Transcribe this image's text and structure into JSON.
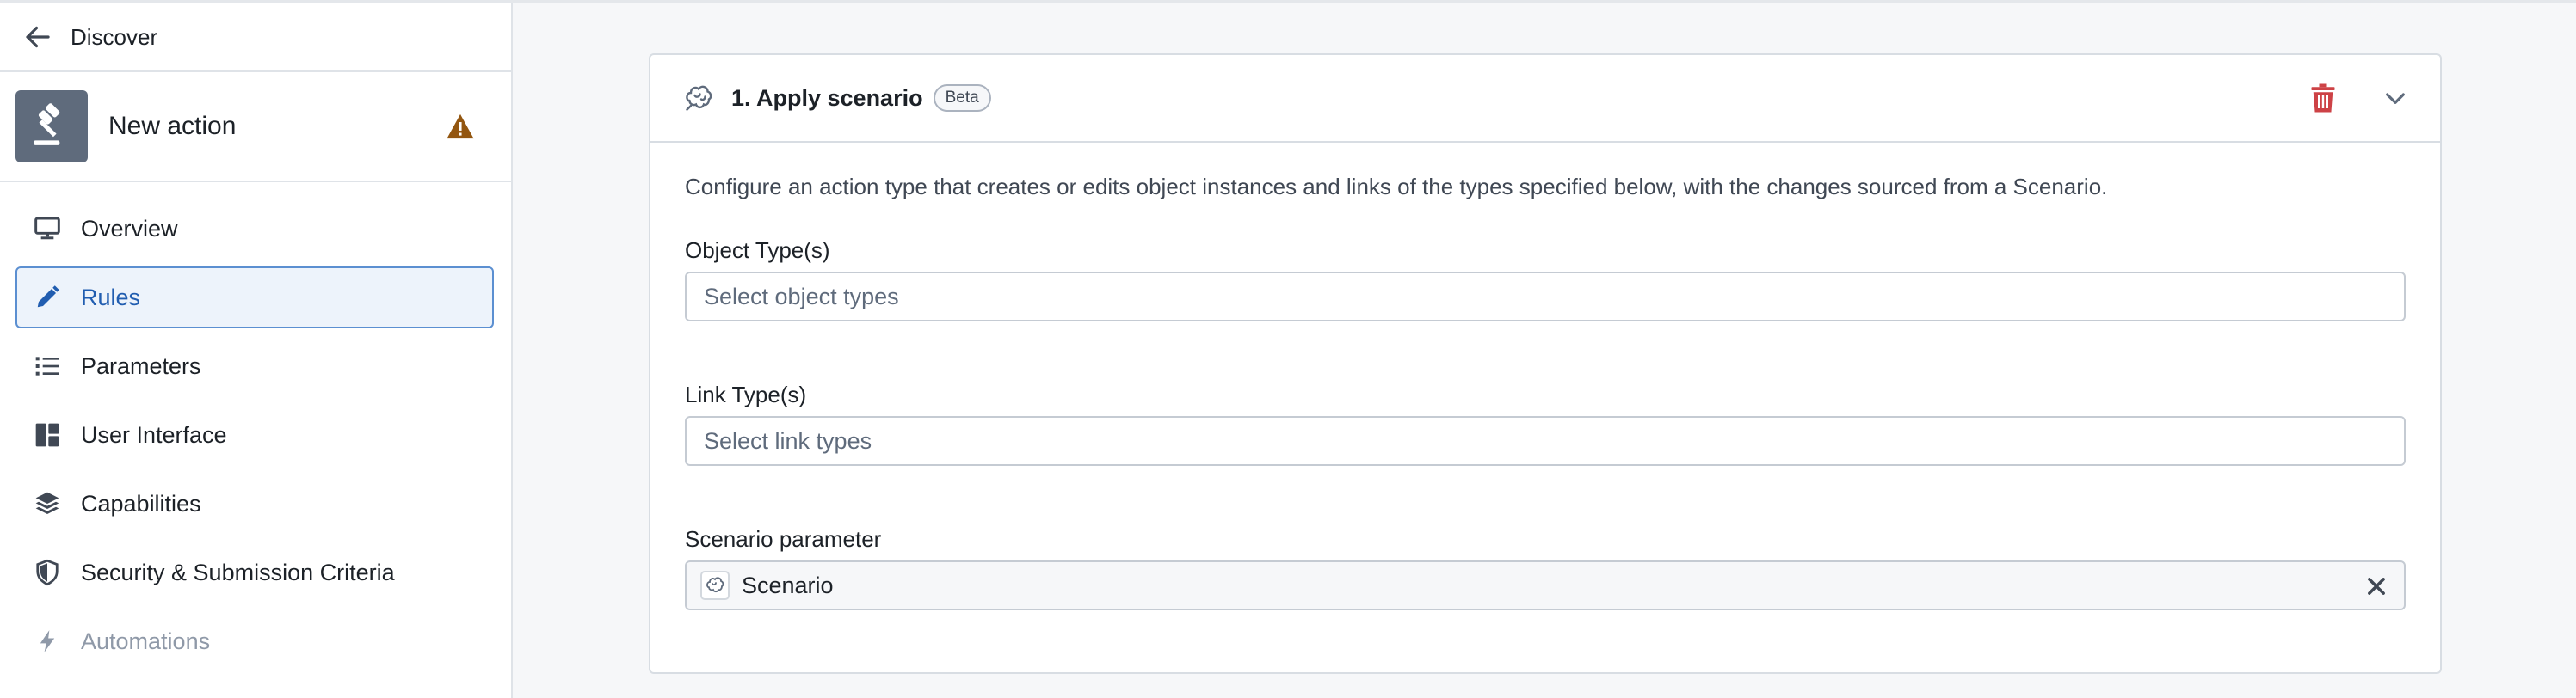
{
  "header": {
    "back_label": "Discover"
  },
  "action": {
    "name": "New action",
    "warning_icon": "warning-icon"
  },
  "sidebar": {
    "items": [
      {
        "label": "Overview",
        "icon": "desktop-icon"
      },
      {
        "label": "Rules",
        "icon": "edit-icon",
        "active": true
      },
      {
        "label": "Parameters",
        "icon": "list-icon"
      },
      {
        "label": "User Interface",
        "icon": "layout-icon"
      },
      {
        "label": "Capabilities",
        "icon": "layers-icon"
      },
      {
        "label": "Security & Submission Criteria",
        "icon": "shield-icon"
      },
      {
        "label": "Automations",
        "icon": "lightning-icon",
        "disabled": true
      }
    ]
  },
  "rule": {
    "title": "1. Apply scenario",
    "badge": "Beta",
    "description": "Configure an action type that creates or edits object instances and links of the types specified below, with the changes sourced from a Scenario.",
    "object_types": {
      "label": "Object Type(s)",
      "placeholder": "Select object types"
    },
    "link_types": {
      "label": "Link Type(s)",
      "placeholder": "Select link types"
    },
    "scenario_param": {
      "label": "Scenario parameter",
      "value": "Scenario"
    }
  },
  "colors": {
    "accent": "#215db0",
    "danger": "#cd4246",
    "warning": "#935610"
  }
}
